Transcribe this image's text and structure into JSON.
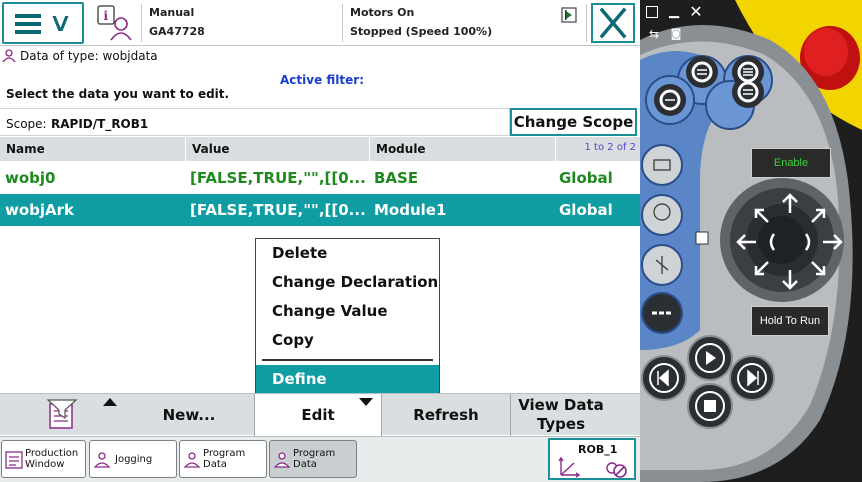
{
  "colors": {
    "accent": "#0f9ca3",
    "accent_border": "#1a8f98",
    "global_text": "#1e8a1e",
    "filter_text": "#1a3fd0",
    "pager_text": "#5a3fd0",
    "enable_text": "#37d13a",
    "device_yellow": "#f2d400",
    "device_blue": "#5a86c8"
  },
  "status": {
    "mode": "Manual",
    "controller": "GA47728",
    "motors": "Motors On",
    "state": "Stopped (Speed 100%)"
  },
  "header": {
    "data_type_label": "Data of type: wobjdata",
    "active_filter": "Active filter:",
    "select_hint": "Select the data you want to edit."
  },
  "scope": {
    "label": "Scope:",
    "value": "RAPID/T_ROB1",
    "change_button": "Change Scope"
  },
  "table": {
    "columns": [
      "Name",
      "Value",
      "Module"
    ],
    "pager": "1 to 2 of 2",
    "rows": [
      {
        "name": "wobj0",
        "value": "[FALSE,TRUE,\"\",[[0...",
        "module": "BASE",
        "scope": "Global"
      },
      {
        "name": "wobjArk",
        "value": "[FALSE,TRUE,\"\",[[0...",
        "module": "Module1",
        "scope": "Global"
      }
    ]
  },
  "context_menu": {
    "items": [
      "Delete",
      "Change Declaration",
      "Change Value",
      "Copy"
    ],
    "define": "Define"
  },
  "commands": {
    "new": "New...",
    "edit": "Edit",
    "refresh": "Refresh",
    "view_line1": "View Data",
    "view_line2": "Types"
  },
  "taskbar": {
    "items": [
      {
        "line1": "Production",
        "line2": "Window"
      },
      {
        "line1": "Jogging",
        "line2": ""
      },
      {
        "line1": "Program",
        "line2": "Data"
      },
      {
        "line1": "Program",
        "line2": "Data"
      }
    ],
    "rob": "ROB_1"
  },
  "device": {
    "enable": "Enable",
    "hold_to_run": "Hold To Run"
  }
}
